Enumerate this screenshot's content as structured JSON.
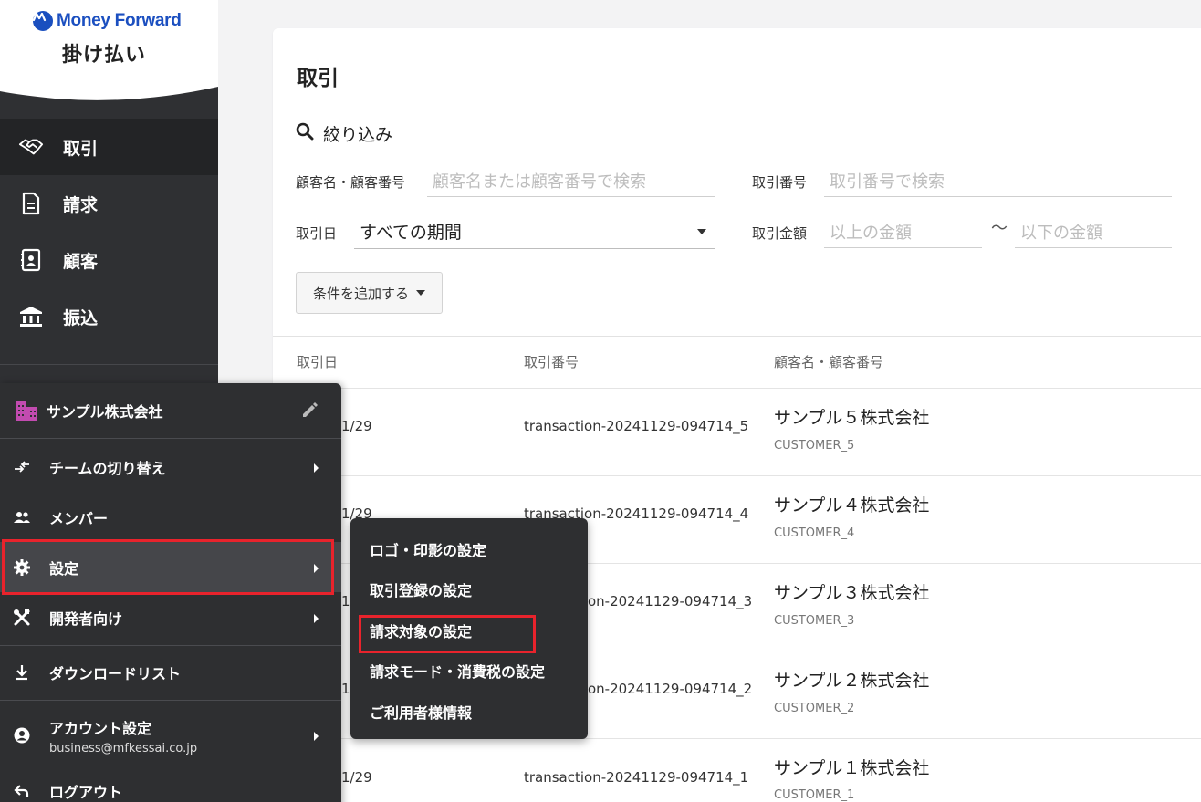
{
  "brand": {
    "logo_text": "Money Forward",
    "product": "掛け払い"
  },
  "sidebar": {
    "items": [
      {
        "label": "取引",
        "icon": "handshake-icon",
        "active": true
      },
      {
        "label": "請求",
        "icon": "document-icon",
        "active": false
      },
      {
        "label": "顧客",
        "icon": "contact-card-icon",
        "active": false
      },
      {
        "label": "振込",
        "icon": "bank-icon",
        "active": false
      }
    ]
  },
  "main": {
    "title": "取引",
    "filter": {
      "heading": "絞り込み",
      "customer_label": "顧客名・顧客番号",
      "customer_placeholder": "顧客名または顧客番号で検索",
      "txn_no_label": "取引番号",
      "txn_no_placeholder": "取引番号で検索",
      "date_label": "取引日",
      "date_value": "すべての期間",
      "amount_label": "取引金額",
      "amount_min_placeholder": "以上の金額",
      "amount_sep": "〜",
      "amount_max_placeholder": "以下の金額",
      "add_condition": "条件を追加する"
    },
    "table": {
      "headers": [
        "取引日",
        "取引番号",
        "顧客名・顧客番号"
      ],
      "rows": [
        {
          "date": "1/29",
          "number": "transaction-20241129-094714_5",
          "name": "サンプル５株式会社",
          "code": "CUSTOMER_5"
        },
        {
          "date": "1/29",
          "number": "transaction-20241129-094714_4",
          "name": "サンプル４株式会社",
          "code": "CUSTOMER_4"
        },
        {
          "date": "1",
          "number": "on-20241129-094714_3",
          "name": "サンプル３株式会社",
          "code": "CUSTOMER_3"
        },
        {
          "date": "1",
          "number": "on-20241129-094714_2",
          "name": "サンプル２株式会社",
          "code": "CUSTOMER_2"
        },
        {
          "date": "1/29",
          "number": "transaction-20241129-094714_1",
          "name": "サンプル１株式会社",
          "code": "CUSTOMER_1"
        }
      ]
    }
  },
  "team_menu": {
    "org_name": "サンプル株式会社",
    "items": {
      "switch_team": "チームの切り替え",
      "members": "メンバー",
      "settings": "設定",
      "developers": "開発者向け",
      "download_list": "ダウンロードリスト",
      "account_settings": "アカウント設定",
      "account_email": "business@mfkessai.co.jp",
      "logout": "ログアウト"
    }
  },
  "settings_submenu": {
    "items": [
      "ロゴ・印影の設定",
      "取引登録の設定",
      "請求対象の設定",
      "請求モード・消費税の設定",
      "ご利用者様情報"
    ]
  },
  "colors": {
    "sidebar_bg": "#2f3033",
    "highlight_red": "#e8232c",
    "brand_blue": "#1b4fc0",
    "org_icon": "#c24bb0"
  }
}
